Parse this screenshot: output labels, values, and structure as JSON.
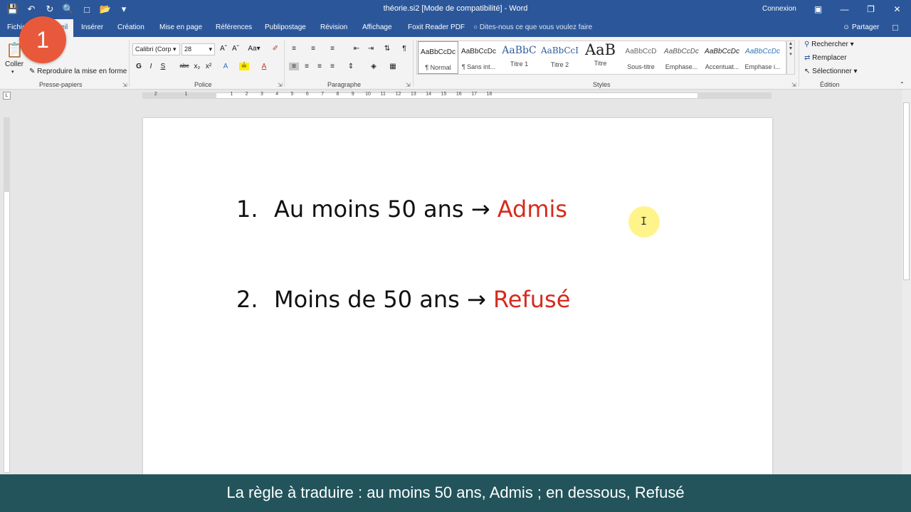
{
  "window": {
    "title": "théorie.si2 [Mode de compatibilité]  -  Word",
    "signin": "Connexion"
  },
  "quick_access": {
    "icons": [
      "save-icon",
      "undo-icon",
      "redo-icon",
      "print-preview-icon",
      "new-document-icon",
      "open-folder-icon",
      "customize-qat-icon"
    ]
  },
  "tabs": {
    "items": [
      {
        "label": "Fichier"
      },
      {
        "label": "Accueil"
      },
      {
        "label": "Insérer"
      },
      {
        "label": "Création"
      },
      {
        "label": "Mise en page"
      },
      {
        "label": "Références"
      },
      {
        "label": "Publipostage"
      },
      {
        "label": "Révision"
      },
      {
        "label": "Affichage"
      },
      {
        "label": "Foxit Reader PDF"
      }
    ],
    "tell_me": "Dites-nous ce que vous voulez faire",
    "share": "Partager"
  },
  "ribbon": {
    "clipboard": {
      "paste": "Coller",
      "format_painter": "Reproduire la mise en forme",
      "label": "Presse-papiers"
    },
    "font": {
      "name": "Calibri (Corp",
      "size": "28",
      "label": "Police"
    },
    "paragraph": {
      "label": "Paragraphe"
    },
    "styles": {
      "label": "Styles",
      "items": [
        {
          "preview": "AaBbCcDc",
          "name": "¶ Normal"
        },
        {
          "preview": "AaBbCcDc",
          "name": "¶ Sans int..."
        },
        {
          "preview": "AaBbC",
          "name": "Titre 1"
        },
        {
          "preview": "AaBbCcI",
          "name": "Titre 2"
        },
        {
          "preview": "AaB",
          "name": "Titre"
        },
        {
          "preview": "AaBbCcD",
          "name": "Sous-titre"
        },
        {
          "preview": "AaBbCcDc",
          "name": "Emphase..."
        },
        {
          "preview": "AaBbCcDc",
          "name": "Accentuat..."
        },
        {
          "preview": "AaBbCcDc",
          "name": "Emphase i..."
        }
      ]
    },
    "editing": {
      "find": "Rechercher",
      "replace": "Remplacer",
      "select": "Sélectionner",
      "label": "Édition"
    }
  },
  "ruler_numbers": [
    "2",
    "1",
    "1",
    "2",
    "3",
    "4",
    "5",
    "6",
    "7",
    "8",
    "9",
    "10",
    "11",
    "12",
    "13",
    "14",
    "15",
    "16",
    "17",
    "18"
  ],
  "document": {
    "items": [
      {
        "number": "1.",
        "text": "Au moins 50 ans → ",
        "result": "Admis"
      },
      {
        "number": "2.",
        "text": "Moins de 50 ans → ",
        "result": "Refusé"
      }
    ]
  },
  "step_badge": "1",
  "subtitle": "La règle à traduire : au moins 50 ans, Admis ; en dessous, Refusé",
  "colors": {
    "word_blue": "#2b579a",
    "result_red": "#d52b1e",
    "badge": "#e8593c",
    "subtitle_bg": "#23545c"
  }
}
